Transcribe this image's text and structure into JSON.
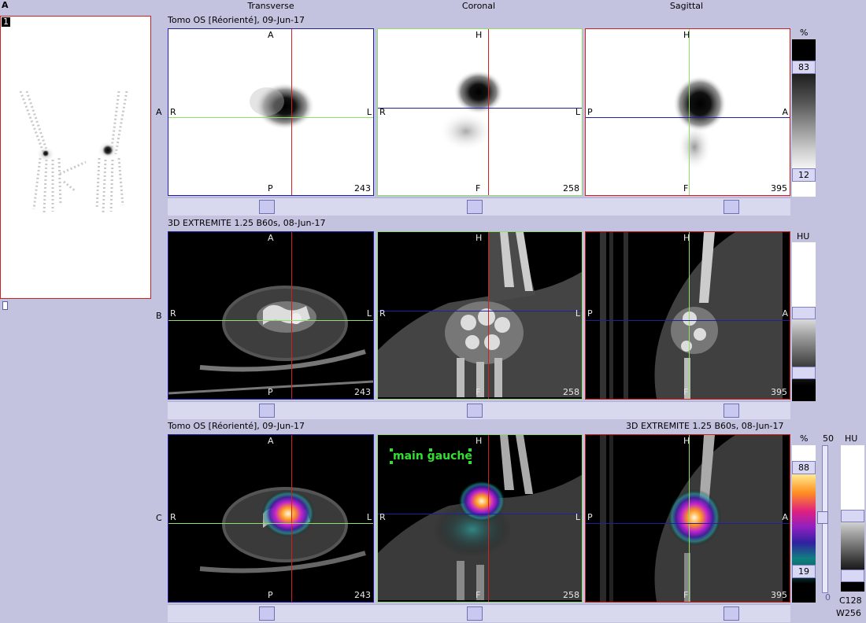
{
  "left_panel": {
    "header": "A",
    "frame_number": "1"
  },
  "columns": {
    "transverse": "Transverse",
    "coronal": "Coronal",
    "sagittal": "Sagittal"
  },
  "rows": [
    {
      "letter": "A",
      "title": "Tomo OS [Réorienté], 09-Jun-17",
      "panes": [
        {
          "top": "A",
          "bottom": "P",
          "left": "R",
          "right": "L",
          "slice": "243"
        },
        {
          "top": "H",
          "bottom": "F",
          "left": "R",
          "right": "L",
          "slice": "258"
        },
        {
          "top": "H",
          "bottom": "F",
          "left": "P",
          "right": "A",
          "slice": "395"
        }
      ],
      "scale": {
        "unit": "%",
        "max": "83",
        "min": "12"
      }
    },
    {
      "letter": "B",
      "title": "3D EXTREMITE  1.25  B60s, 08-Jun-17",
      "panes": [
        {
          "top": "A",
          "bottom": "P",
          "left": "R",
          "right": "L",
          "slice": "243"
        },
        {
          "top": "H",
          "bottom": "F",
          "left": "R",
          "right": "L",
          "slice": "258"
        },
        {
          "top": "H",
          "bottom": "F",
          "left": "P",
          "right": "A",
          "slice": "395"
        }
      ],
      "scale": {
        "unit": "HU"
      }
    },
    {
      "letter": "C",
      "title": "Tomo OS [Réorienté], 09-Jun-17",
      "title_right": "3D EXTREMITE  1.25  B60s, 08-Jun-17",
      "annotation": "main gauche",
      "panes": [
        {
          "top": "A",
          "bottom": "P",
          "left": "R",
          "right": "L",
          "slice": "243"
        },
        {
          "top": "H",
          "bottom": "F",
          "left": "R",
          "right": "L",
          "slice": "258"
        },
        {
          "top": "H",
          "bottom": "F",
          "left": "P",
          "right": "A",
          "slice": "395"
        }
      ],
      "scale": {
        "unit": "%",
        "max": "88",
        "min": "19"
      },
      "blend": {
        "top": "50",
        "bottom": "0"
      },
      "hu_scale": {
        "unit": "HU",
        "c": "C128",
        "w": "W256"
      }
    }
  ],
  "colors": {
    "background": "#c3c3e0",
    "crosshair_red": "#d02020",
    "crosshair_green": "#8ee06a",
    "crosshair_blue": "#2020a0"
  }
}
